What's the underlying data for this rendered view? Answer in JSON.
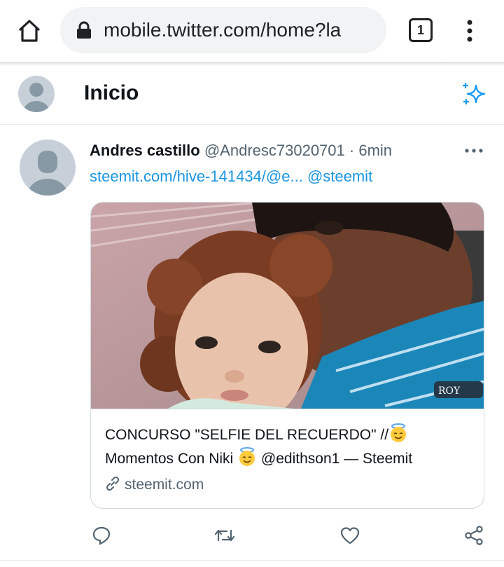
{
  "browser": {
    "url": "mobile.twitter.com/home?la",
    "tab_count": "1",
    "icons": {
      "home": "home-icon",
      "lock": "lock-icon",
      "menu": "vertical-dots-icon"
    }
  },
  "header": {
    "title": "Inicio",
    "icons": {
      "avatar": "profile-avatar",
      "sparkle": "sparkle-icon"
    },
    "accent_color": "#1d9bf0"
  },
  "tweet": {
    "author_name": "Andres castillo",
    "author_handle": "@Andresc73020701",
    "separator": "·",
    "time": "6min",
    "text_link": "steemit.com/hive-141434/@e...",
    "text_mention": "@steemit",
    "card": {
      "title_part1": "CONCURSO \"SELFIE DEL RECUERDO\" //",
      "title_part2": "Momentos Con Niki",
      "title_part3": "@edithson1 — Steemit",
      "domain": "steemit.com",
      "image": "photo-man-kissing-child"
    },
    "actions": [
      "reply-icon",
      "retweet-icon",
      "like-icon",
      "share-icon"
    ]
  },
  "colors": {
    "link": "#1b95e0",
    "secondary_text": "#536471",
    "border": "#cfd9de"
  }
}
